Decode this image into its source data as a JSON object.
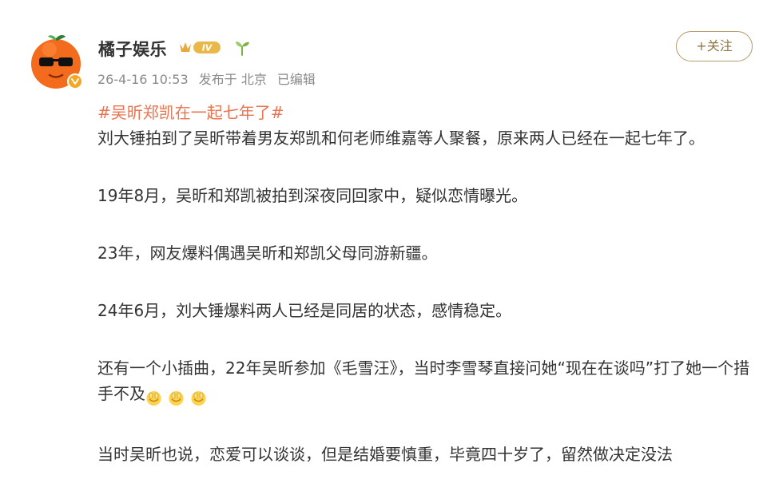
{
  "post": {
    "username": "橘子娱乐",
    "level_badge": "IV",
    "meta": {
      "timestamp": "26-4-16 10:53",
      "location": "发布于 北京",
      "edited": "已编辑"
    },
    "follow_label": "+关注",
    "hashtag": "#吴昕郑凯在一起七年了#",
    "paragraphs": [
      "刘大锤拍到了吴昕带着男友郑凯和何老师维嘉等人聚餐，原来两人已经在一起七年了。",
      "19年8月，吴昕和郑凯被拍到深夜同回家中，疑似恋情曝光。",
      "23年，网友爆料偶遇吴昕和郑凯父母同游新疆。",
      "24年6月，刘大锤爆料两人已经是同居的状态，感情稳定。",
      "还有一个小插曲，22年吴昕参加《毛雪汪》，当时李雪琴直接问她“现在在谈吗”打了她一个措手不及",
      "当时吴昕也说，恋爱可以谈谈，但是结婚要慎重，毕竟四十岁了，留然做决定没法"
    ],
    "emojis": [
      "hands-clap-emoji",
      "hands-clap-emoji",
      "hands-clap-emoji"
    ]
  },
  "colors": {
    "hashtag": "#eb7350",
    "follow_border": "#b59a6a",
    "avatar_orange": "#f36b1c",
    "meta_gray": "#8a8a8a"
  }
}
